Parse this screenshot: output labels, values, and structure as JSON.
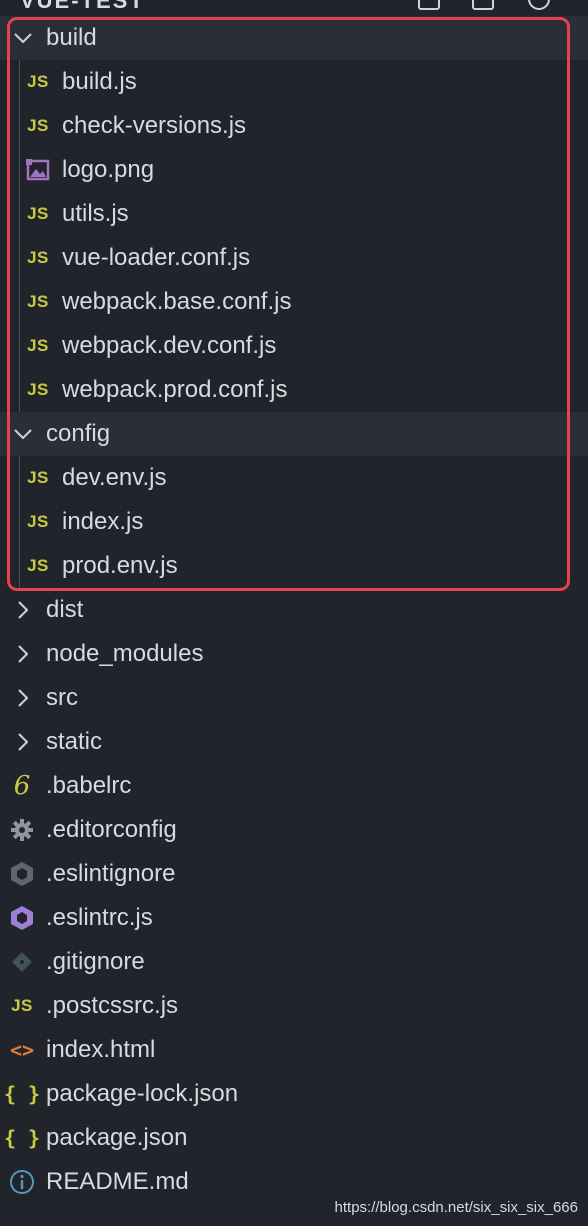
{
  "window": {
    "title": "VUE-TEST"
  },
  "tree": {
    "build": {
      "label": "build",
      "files": [
        {
          "name": "build.js",
          "icon": "js-icon"
        },
        {
          "name": "check-versions.js",
          "icon": "js-icon"
        },
        {
          "name": "logo.png",
          "icon": "image-icon"
        },
        {
          "name": "utils.js",
          "icon": "js-icon"
        },
        {
          "name": "vue-loader.conf.js",
          "icon": "js-icon"
        },
        {
          "name": "webpack.base.conf.js",
          "icon": "js-icon"
        },
        {
          "name": "webpack.dev.conf.js",
          "icon": "js-icon"
        },
        {
          "name": "webpack.prod.conf.js",
          "icon": "js-icon"
        }
      ]
    },
    "config": {
      "label": "config",
      "files": [
        {
          "name": "dev.env.js",
          "icon": "js-icon"
        },
        {
          "name": "index.js",
          "icon": "js-icon"
        },
        {
          "name": "prod.env.js",
          "icon": "js-icon"
        }
      ]
    },
    "collapsed_folders": [
      {
        "name": "dist"
      },
      {
        "name": "node_modules"
      },
      {
        "name": "src"
      },
      {
        "name": "static"
      }
    ],
    "root_files": [
      {
        "name": ".babelrc",
        "icon": "babel-icon"
      },
      {
        "name": ".editorconfig",
        "icon": "gear-icon"
      },
      {
        "name": ".eslintignore",
        "icon": "eslint-grey-icon"
      },
      {
        "name": ".eslintrc.js",
        "icon": "eslint-purple-icon"
      },
      {
        "name": ".gitignore",
        "icon": "git-icon"
      },
      {
        "name": ".postcssrc.js",
        "icon": "js-icon"
      },
      {
        "name": "index.html",
        "icon": "html-icon"
      },
      {
        "name": "package-lock.json",
        "icon": "json-icon"
      },
      {
        "name": "package.json",
        "icon": "json-icon"
      },
      {
        "name": "README.md",
        "icon": "info-icon"
      }
    ]
  },
  "icon_glyphs": {
    "js": "JS",
    "json": "{ }",
    "babel": "6",
    "html": "<>"
  },
  "colors": {
    "background": "#21252b",
    "open_folder_row": "#2a2f37",
    "js": "#cbcb41",
    "highlight": "#e5424d",
    "html": "#e37933",
    "eslint": "#9f7fd6",
    "info": "#519aba"
  },
  "watermark": "https://blog.csdn.net/six_six_six_666"
}
